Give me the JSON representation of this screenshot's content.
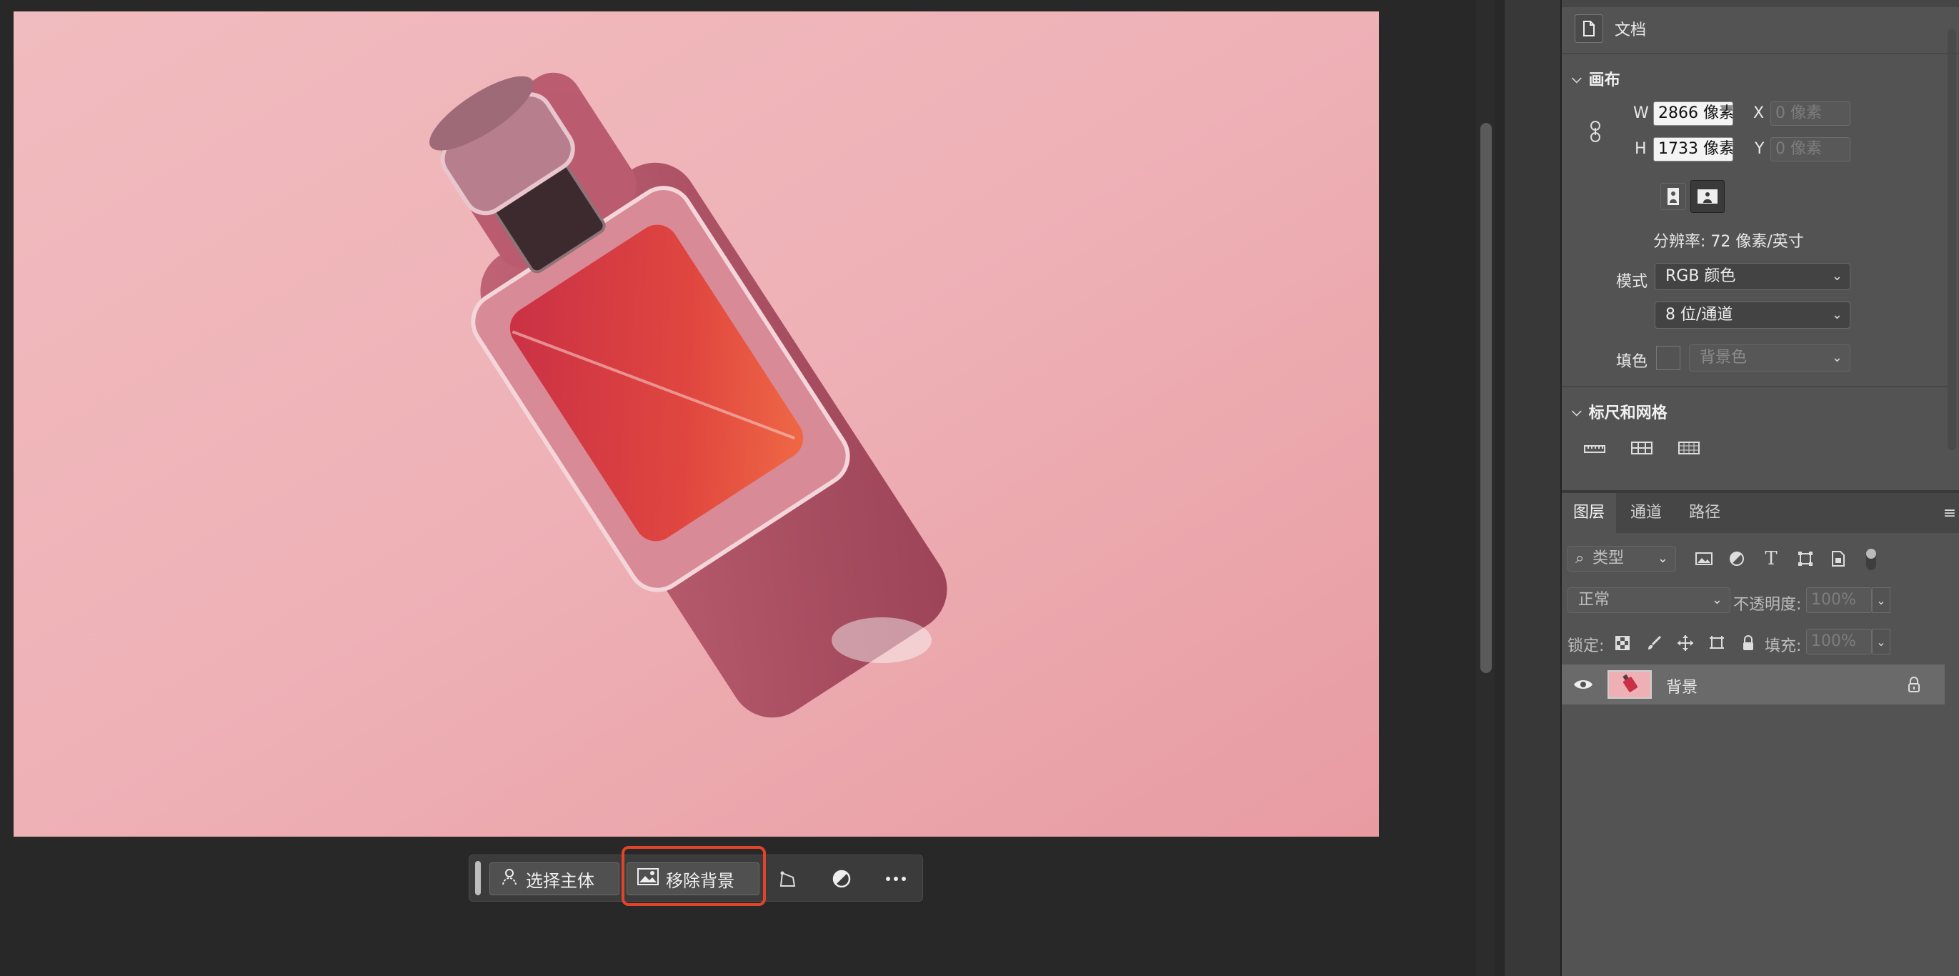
{
  "toolbar": {
    "select_subject": "选择主体",
    "remove_background": "移除背景"
  },
  "properties": {
    "document_label": "文档",
    "canvas_section": "画布",
    "width_label": "W",
    "width_value": "2866 像素",
    "height_label": "H",
    "height_value": "1733 像素",
    "x_label": "X",
    "x_placeholder": "0 像素",
    "y_label": "Y",
    "y_placeholder": "0 像素",
    "resolution": "分辨率: 72 像素/英寸",
    "mode_label": "模式",
    "mode_value": "RGB 颜色",
    "bit_depth_value": "8 位/通道",
    "fill_label": "填色",
    "fill_value": "背景色",
    "rulers_section": "标尺和网格"
  },
  "layers": {
    "tabs": [
      "图层",
      "通道",
      "路径"
    ],
    "active_tab": 0,
    "filter_type": "类型",
    "blend_mode": "正常",
    "opacity_label": "不透明度:",
    "opacity_value": "100%",
    "lock_label": "锁定:",
    "fill_label": "填充:",
    "fill_value": "100%",
    "items": [
      {
        "name": "背景",
        "visible": true,
        "locked": true
      }
    ]
  },
  "colors": {
    "canvas_pink": "#e8a1a6",
    "highlight": "#e0442a",
    "panel_bg": "#535353"
  }
}
